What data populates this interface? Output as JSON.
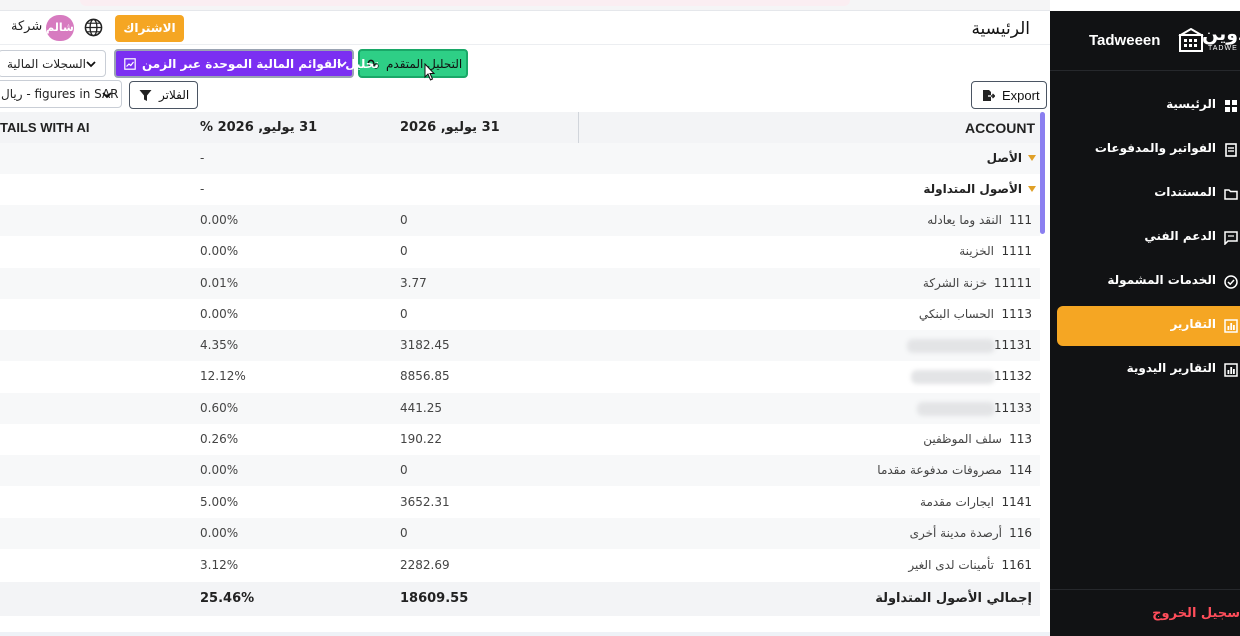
{
  "brand": {
    "name": "Tadweeen",
    "logo_ar": "دوين",
    "logo_en": "TADWE"
  },
  "sidebar": {
    "items": [
      {
        "label": "الرئيسية",
        "icon": "grid-icon",
        "active": false
      },
      {
        "label": "الفواتير والمدفوعات",
        "icon": "receipt-icon",
        "active": false
      },
      {
        "label": "المستندات",
        "icon": "folder-icon",
        "active": false
      },
      {
        "label": "الدعم الفني",
        "icon": "chat-icon",
        "active": false
      },
      {
        "label": "الخدمات المشمولة",
        "icon": "check-circle-icon",
        "active": false
      },
      {
        "label": "التقارير",
        "icon": "bar-chart-icon",
        "active": true
      },
      {
        "label": "التقارير اليدوية",
        "icon": "bar-chart-icon",
        "active": false
      }
    ],
    "logout_label": "سجيل الخروج"
  },
  "header": {
    "title": "الرئيسية",
    "subscribe_label": "الاشتراك",
    "avatar_text": "شالم",
    "company_label": "شركة"
  },
  "toolbar": {
    "advanced_label": "التحليل المتقدم",
    "consolidated_label": "تحليل القوائم المالية الموحدة عبر الزمن",
    "records_label": "السجلات المالية",
    "export_label": "Export",
    "filters_label": "الفلاتر",
    "currency_label": "ريال - figures in SAR"
  },
  "table": {
    "headers": {
      "account": "ACCOUNT",
      "date": "31 يوليو, 2026",
      "pct": "31 يوليو, 2026 %",
      "ai": "TAILS WITH AI"
    },
    "groups": [
      {
        "label": "الأصل",
        "pct": "-"
      },
      {
        "label": "الأصول المتداولة",
        "pct": "-"
      }
    ],
    "rows": [
      {
        "code": "111",
        "name": "النقد وما يعادله",
        "value": "0",
        "pct": "0.00%",
        "redacted": false
      },
      {
        "code": "1111",
        "name": "الخزينة",
        "value": "0",
        "pct": "0.00%",
        "redacted": false
      },
      {
        "code": "11111",
        "name": "خزنة الشركة",
        "value": "3.77",
        "pct": "0.01%",
        "redacted": false
      },
      {
        "code": "1113",
        "name": "الحساب البنكي",
        "value": "0",
        "pct": "0.00%",
        "redacted": false
      },
      {
        "code": "11131",
        "name": "",
        "value": "3182.45",
        "pct": "4.35%",
        "redacted": true
      },
      {
        "code": "11132",
        "name": "",
        "value": "8856.85",
        "pct": "12.12%",
        "redacted": true
      },
      {
        "code": "11133",
        "name": "",
        "value": "441.25",
        "pct": "0.60%",
        "redacted": true
      },
      {
        "code": "113",
        "name": "سلف الموظفين",
        "value": "190.22",
        "pct": "0.26%",
        "redacted": false
      },
      {
        "code": "114",
        "name": "مصروفات مدفوعة مقدما",
        "value": "0",
        "pct": "0.00%",
        "redacted": false
      },
      {
        "code": "1141",
        "name": "ايجارات مقدمة",
        "value": "3652.31",
        "pct": "5.00%",
        "redacted": false
      },
      {
        "code": "116",
        "name": "أرصدة مدينة أخرى",
        "value": "0",
        "pct": "0.00%",
        "redacted": false
      },
      {
        "code": "1161",
        "name": "تأمينات لدى الغير",
        "value": "2282.69",
        "pct": "3.12%",
        "redacted": false
      }
    ],
    "total": {
      "label": "إجمالي الأصول المتداولة",
      "value": "18609.55",
      "pct": "25.46%"
    }
  },
  "colors": {
    "accent": "#f5a623",
    "advanced_btn": "#2ecf86",
    "consolidated_btn": "#7b2ff2",
    "sidebar_bg": "#111214",
    "logout": "#ff4d5a"
  }
}
